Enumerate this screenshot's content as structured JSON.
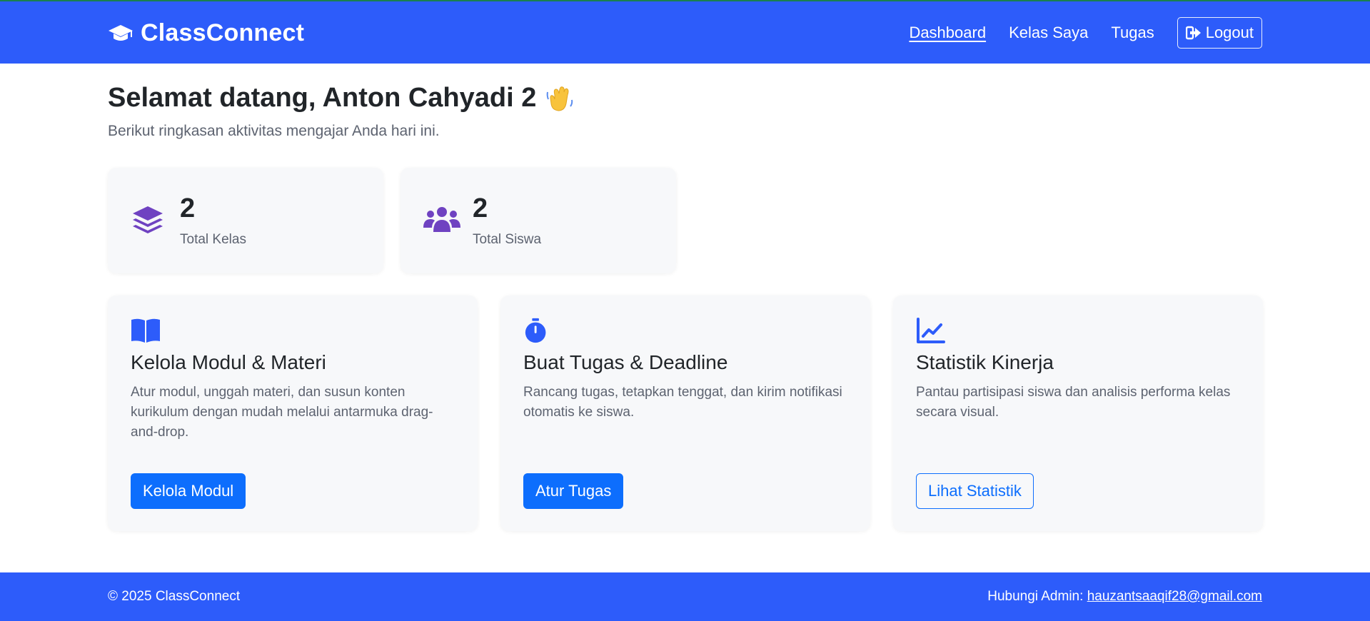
{
  "navbar": {
    "brand": "ClassConnect",
    "brand_icon": "graduation-cap-icon",
    "links": [
      "Dashboard",
      "Kelas Saya",
      "Tugas"
    ],
    "logout_label": "Logout",
    "logout_icon": "sign-out-icon"
  },
  "welcome": {
    "title": "Selamat datang, Anton Cahyadi 2",
    "emoji": "waving-hand",
    "subtitle": "Berikut ringkasan aktivitas mengajar Anda hari ini."
  },
  "stats": [
    {
      "value": "2",
      "label": "Total Kelas",
      "icon": "layers-icon"
    },
    {
      "value": "2",
      "label": "Total Siswa",
      "icon": "users-icon"
    }
  ],
  "features": [
    {
      "icon": "book-open-icon",
      "title": "Kelola Modul & Materi",
      "description": "Atur modul, unggah materi, dan susun konten kurikulum dengan mudah melalui antarmuka drag-and-drop.",
      "button": "Kelola Modul"
    },
    {
      "icon": "stopwatch-icon",
      "title": "Buat Tugas & Deadline",
      "description": "Rancang tugas, tetapkan tenggat, dan kirim notifikasi otomatis ke siswa.",
      "button": "Atur Tugas"
    },
    {
      "icon": "line-chart-icon",
      "title": "Statistik Kinerja",
      "description": "Pantau partisipasi siswa dan analisis performa kelas secara visual.",
      "button": "Lihat Statistik"
    }
  ],
  "footer": {
    "copyright": "© 2025 ClassConnect",
    "contact_label": "Hubungi Admin:",
    "contact_email": "hauzantsaaqif28@gmail.com"
  },
  "colors": {
    "primary": "#2d5cfa",
    "button": "#0d6efd",
    "stat_icon": "#6f42c1",
    "card_bg": "#f7f8fa"
  }
}
